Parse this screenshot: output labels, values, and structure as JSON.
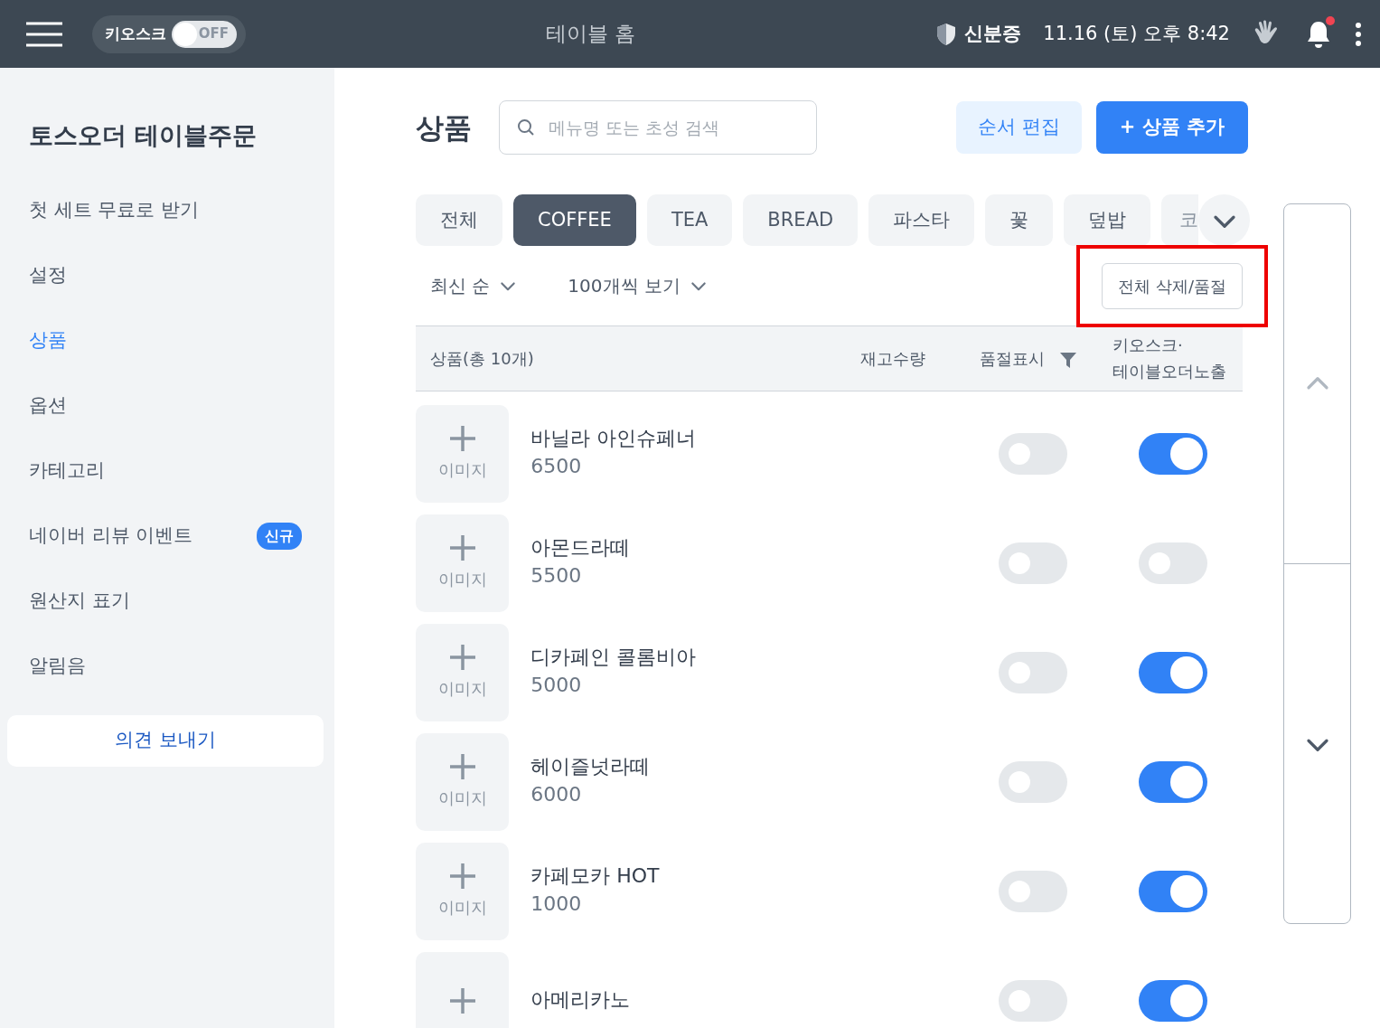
{
  "header": {
    "kiosk_label": "키오스크",
    "kiosk_toggle": {
      "on": false,
      "text": "OFF"
    },
    "title": "테이블 홈",
    "id_label": "신분증",
    "datetime": "11.16 (토) 오후 8:42",
    "notification": {
      "unread": true
    }
  },
  "sidebar": {
    "title": "토스오더 테이블주문",
    "items": [
      {
        "label": "첫 세트 무료로 받기",
        "selected": false
      },
      {
        "label": "설정",
        "selected": false
      },
      {
        "label": "상품",
        "selected": true
      },
      {
        "label": "옵션",
        "selected": false
      },
      {
        "label": "카테고리",
        "selected": false
      },
      {
        "label": "네이버 리뷰 이벤트",
        "selected": false,
        "badge": "신규"
      },
      {
        "label": "원산지 표기",
        "selected": false
      },
      {
        "label": "알림음",
        "selected": false
      }
    ],
    "feedback_button": "의견 보내기"
  },
  "page": {
    "title": "상품",
    "search": {
      "placeholder": "메뉴명 또는 초성 검색"
    },
    "reorder_button": "순서 편집",
    "add_button": "+ 상품 추가"
  },
  "categories": [
    {
      "label": "전체",
      "selected": false
    },
    {
      "label": "COFFEE",
      "selected": true
    },
    {
      "label": "TEA",
      "selected": false
    },
    {
      "label": "BREAD",
      "selected": false
    },
    {
      "label": "파스타",
      "selected": false
    },
    {
      "label": "꽃",
      "selected": false
    },
    {
      "label": "덮밥",
      "selected": false
    },
    {
      "label": "코",
      "selected": false
    }
  ],
  "filters": {
    "sort": "최신 순",
    "page_size": "100개씩 보기",
    "bulk_button": "전체 삭제/품절",
    "bulk_button_highlighted": true
  },
  "table": {
    "columns": [
      "상품(총 10개)",
      "재고수량",
      "품절표시",
      "키오스크·\n테이블오더노출"
    ],
    "rows": [
      {
        "image_label": "이미지",
        "name": "바닐라 아인슈페너",
        "price": "6500",
        "sold_out": false,
        "visible": true
      },
      {
        "image_label": "이미지",
        "name": "아몬드라떼",
        "price": "5500",
        "sold_out": false,
        "visible": false
      },
      {
        "image_label": "이미지",
        "name": "디카페인 콜롬비아",
        "price": "5000",
        "sold_out": false,
        "visible": true
      },
      {
        "image_label": "이미지",
        "name": "헤이즐넛라떼",
        "price": "6000",
        "sold_out": false,
        "visible": true
      },
      {
        "image_label": "이미지",
        "name": "카페모카 HOT",
        "price": "1000",
        "sold_out": false,
        "visible": true
      },
      {
        "name": "아메리카노",
        "sold_out": false,
        "visible": true
      }
    ]
  }
}
